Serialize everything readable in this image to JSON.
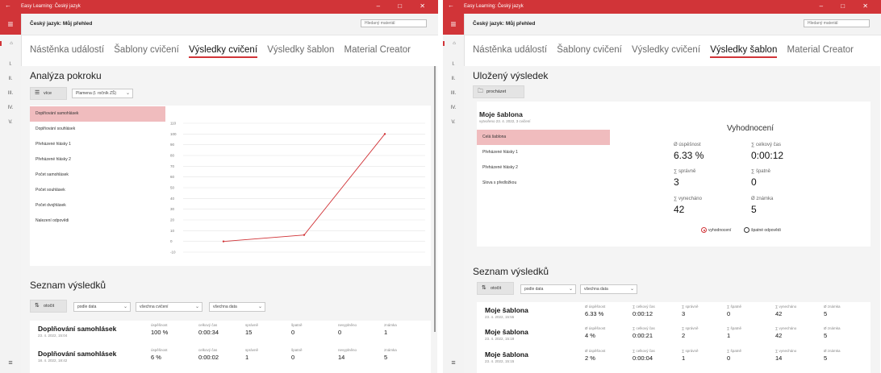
{
  "app": {
    "window_title": "Easy Learning: Český jazyk",
    "header_title": "Český jazyk: Můj přehled",
    "search_placeholder": "Hledaný materiál",
    "back_glyph": "←",
    "controls": "–  □  ✕",
    "rail_items": [
      "I.",
      "II.",
      "III.",
      "IV.",
      "V."
    ],
    "tabs": [
      "Nástěnka událostí",
      "Šablony cvičení",
      "Výsledky cvičení",
      "Výsledky šablon",
      "Material Creator"
    ]
  },
  "colors": {
    "accent": "#d13438",
    "selected_row": "#f0bcbe",
    "line": "#d13438"
  },
  "left": {
    "selected_tab": "Výsledky cvičení",
    "section_title": "Analýza pokroku",
    "more_button": "více",
    "group_dropdown": "Plamena (I. ročník ZŠ)",
    "list": [
      "Doplňování samohlásek",
      "Doplňování souhlásek",
      "Přeházené hlásky 1",
      "Přeházené hlásky 2",
      "Počet samohlásek",
      "Počet souhlásek",
      "Počet dvojhlásek",
      "Nalezení odpovědi"
    ],
    "results_title": "Seznam výsledků",
    "flip_button": "otočit",
    "sort_dropdown": "podle data",
    "filter_exercise": "všechna cvičení",
    "filter_data": "všechna data",
    "col_labels": [
      "úspěšnost",
      "celkový čas",
      "správně",
      "špatně",
      "nevyplněno",
      "známka"
    ],
    "results": [
      {
        "name": "Doplňování samohlásek",
        "date": "23. 4. 2022, 15:04",
        "values": [
          "100 %",
          "0:00:34",
          "15",
          "0",
          "0",
          "1"
        ]
      },
      {
        "name": "Doplňování samohlásek",
        "date": "18. 4. 2022, 18:42",
        "values": [
          "6 %",
          "0:00:02",
          "1",
          "0",
          "14",
          "5"
        ]
      }
    ]
  },
  "chart_data": {
    "type": "line",
    "title": "",
    "xlabel": "",
    "ylabel": "",
    "ylim": [
      -10,
      110
    ],
    "yticks": [
      110,
      100,
      90,
      80,
      70,
      60,
      50,
      40,
      30,
      20,
      10,
      0,
      -10
    ],
    "series": [
      {
        "x": [
          1,
          2,
          3
        ],
        "values": [
          0,
          6,
          100
        ]
      }
    ],
    "grid": true,
    "legend": "none"
  },
  "right": {
    "selected_tab": "Výsledky šablon",
    "section_title": "Uložený výsledek",
    "browse_button": "procházet",
    "template_name": "Moje šablona",
    "template_meta": "vytvořeno 23. 4. 2022, 3 cvičení",
    "list": [
      "Celá šablona",
      "Přeházené hlásky 1",
      "Přeházené hlásky 2",
      "Slova s předložkou"
    ],
    "eval_title": "Vyhodnocení",
    "metrics": [
      {
        "label": "Ø úspěšnost",
        "value": "6.33 %"
      },
      {
        "label": "∑ celkový čas",
        "value": "0:00:12"
      },
      {
        "label": "∑ správně",
        "value": "3"
      },
      {
        "label": "∑ špatně",
        "value": "0"
      },
      {
        "label": "∑ vynecháno",
        "value": "42"
      },
      {
        "label": "Ø známka",
        "value": "5"
      }
    ],
    "radio_eval": "vyhodnocení",
    "radio_wrong": "špatné odpovědi",
    "results_title": "Seznam výsledků",
    "flip_button": "otočit",
    "sort_dropdown": "podle data",
    "filter_data": "všechna data",
    "col_labels": [
      "Ø úspěšnost",
      "∑ celkový čas",
      "∑ správně",
      "∑ špatně",
      "∑ vynecháno",
      "Ø známka"
    ],
    "results": [
      {
        "name": "Moje šablona",
        "date": "23. 4. 2022, 15:55",
        "values": [
          "6.33 %",
          "0:00:12",
          "3",
          "0",
          "42",
          "5"
        ]
      },
      {
        "name": "Moje šablona",
        "date": "23. 4. 2022, 15:18",
        "values": [
          "4 %",
          "0:00:21",
          "2",
          "1",
          "42",
          "5"
        ]
      },
      {
        "name": "Moje šablona",
        "date": "23. 4. 2022, 15:15",
        "values": [
          "2 %",
          "0:00:04",
          "1",
          "0",
          "14",
          "5"
        ]
      }
    ]
  }
}
